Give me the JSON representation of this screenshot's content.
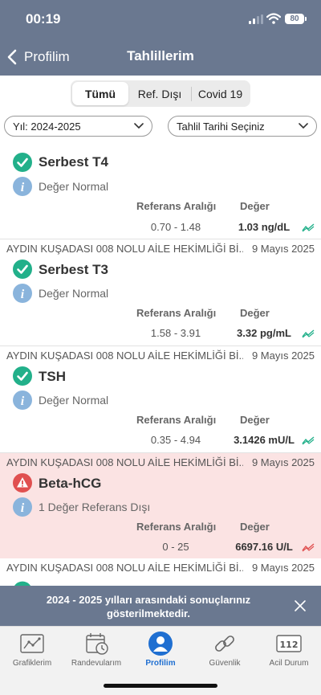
{
  "status_bar": {
    "time": "00:19",
    "battery": "80"
  },
  "nav": {
    "back_label": "Profilim",
    "title": "Tahlillerim"
  },
  "segments": [
    "Tümü",
    "Ref. Dışı",
    "Covid 19"
  ],
  "filters": {
    "year": "Yıl: 2024-2025",
    "date": "Tahlil Tarihi Seçiniz"
  },
  "labels": {
    "ref_header": "Referans Aralığı",
    "value_header": "Değer"
  },
  "results": [
    {
      "lab": "",
      "date": "",
      "name": "Serbest T4",
      "status": "normal",
      "note": "Değer Normal",
      "ref": "0.70 - 1.48",
      "value": "1.03 ng/dL"
    },
    {
      "lab": "AYDIN KUŞADASI 008 NOLU AİLE HEKİMLİĞİ Bİ...",
      "date": "9 Mayıs 2025",
      "name": "Serbest T3",
      "status": "normal",
      "note": "Değer Normal",
      "ref": "1.58 - 3.91",
      "value": "3.32 pg/mL"
    },
    {
      "lab": "AYDIN KUŞADASI 008 NOLU AİLE HEKİMLİĞİ Bİ...",
      "date": "9 Mayıs 2025",
      "name": "TSH",
      "status": "normal",
      "note": "Değer Normal",
      "ref": "0.35 - 4.94",
      "value": "3.1426 mU/L"
    },
    {
      "lab": "AYDIN KUŞADASI 008 NOLU AİLE HEKİMLİĞİ Bİ...",
      "date": "9 Mayıs 2025",
      "name": "Beta-hCG",
      "status": "abnormal",
      "note": "1 Değer Referans Dışı",
      "ref": "0 - 25",
      "value": "6697.16 U/L"
    },
    {
      "lab": "AYDIN KUŞADASI 008 NOLU AİLE HEKİMLİĞİ Bİ...",
      "date": "9 Mayıs 2025"
    }
  ],
  "toast": {
    "message": "2024 - 2025 yılları arasındaki sonuçlarınız gösterilmektedir."
  },
  "tabs": [
    {
      "label": "Grafiklerim",
      "icon": "chart-icon"
    },
    {
      "label": "Randevularım",
      "icon": "calendar-icon"
    },
    {
      "label": "Profilim",
      "icon": "person-icon",
      "active": true
    },
    {
      "label": "Güvenlik",
      "icon": "link-icon"
    },
    {
      "label": "Acil Durum",
      "icon": "emergency-112-icon",
      "badge": "112"
    }
  ],
  "colors": {
    "header": "#6a7890",
    "normal": "#22b08a",
    "alert": "#e05050",
    "info": "#8ab4dc",
    "active_tab": "#1f6fd1",
    "alert_bg": "#fbe3e3"
  }
}
